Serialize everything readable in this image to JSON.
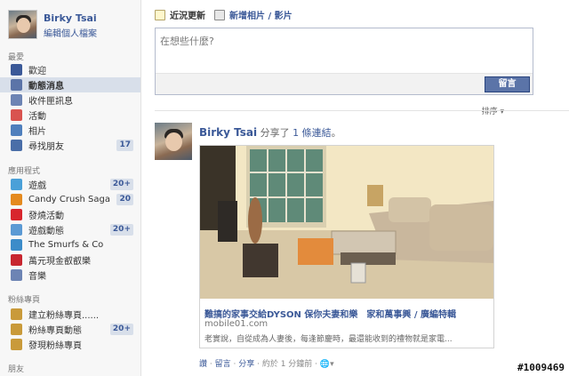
{
  "user": {
    "name": "Birky Tsai",
    "edit_profile": "編輯個人檔案"
  },
  "sidebar": {
    "section_favorites": "最愛",
    "favorites": [
      {
        "label": "歡迎",
        "icon": "facebook-icon",
        "color": "#3b5998"
      },
      {
        "label": "動態消息",
        "icon": "news-feed-icon",
        "color": "#5b74a8"
      },
      {
        "label": "收件匣訊息",
        "icon": "messages-icon",
        "color": "#6d84b4"
      },
      {
        "label": "活動",
        "icon": "events-icon",
        "color": "#d9534f"
      },
      {
        "label": "相片",
        "icon": "photos-icon",
        "color": "#4f7fbd"
      },
      {
        "label": "尋找朋友",
        "icon": "find-friends-icon",
        "color": "#4a6ea8",
        "badge": "17"
      }
    ],
    "section_apps": "應用程式",
    "apps": [
      {
        "label": "遊戲",
        "icon": "games-icon",
        "color": "#4aa0d8",
        "badge": "20+"
      },
      {
        "label": "Candy Crush Saga",
        "icon": "candy-crush-icon",
        "color": "#e58a1f",
        "badge": "20"
      },
      {
        "label": "發燒活動",
        "icon": "hot-events-icon",
        "color": "#d8262d"
      },
      {
        "label": "遊戲動態",
        "icon": "game-feed-icon",
        "color": "#5b9ad4",
        "badge": "20+"
      },
      {
        "label": "The Smurfs & Co",
        "icon": "smurfs-icon",
        "color": "#3c8cc9"
      },
      {
        "label": "萬元現金叡叡樂",
        "icon": "cash-game-icon",
        "color": "#c8262f"
      },
      {
        "label": "音樂",
        "icon": "music-icon",
        "color": "#6d84b4"
      }
    ],
    "section_pages": "粉絲專頁",
    "pages": [
      {
        "label": "建立粉絲專頁......",
        "icon": "create-page-icon",
        "color": "#c99a3a"
      },
      {
        "label": "粉絲專頁動態",
        "icon": "pages-feed-icon",
        "color": "#c99a3a",
        "badge": "20+"
      },
      {
        "label": "發現粉絲專頁",
        "icon": "discover-pages-icon",
        "color": "#c99a3a"
      }
    ],
    "section_friends": "朋友"
  },
  "composer": {
    "tab_status": "近況更新",
    "tab_photo": "新增相片 / 影片",
    "placeholder": "在想些什麼?",
    "post_button": "留言"
  },
  "feed": {
    "sort_label": "排序",
    "story": {
      "author": "Birky Tsai",
      "verb": "分享了",
      "count": "1 條連結",
      "suffix": "。",
      "link_title": "難搞的家事交給DYSON 保你夫妻和樂　家和萬事興 / 廣編特輯",
      "link_domain": "mobile01.com",
      "link_desc": "老實說，自從成為人妻後，每逢節慶時，最還能收到的禮物就是家電...",
      "actions": [
        "讚",
        "留言",
        "分享"
      ],
      "time": "約於 1 分鐘前"
    }
  },
  "watermark": "#1009469"
}
